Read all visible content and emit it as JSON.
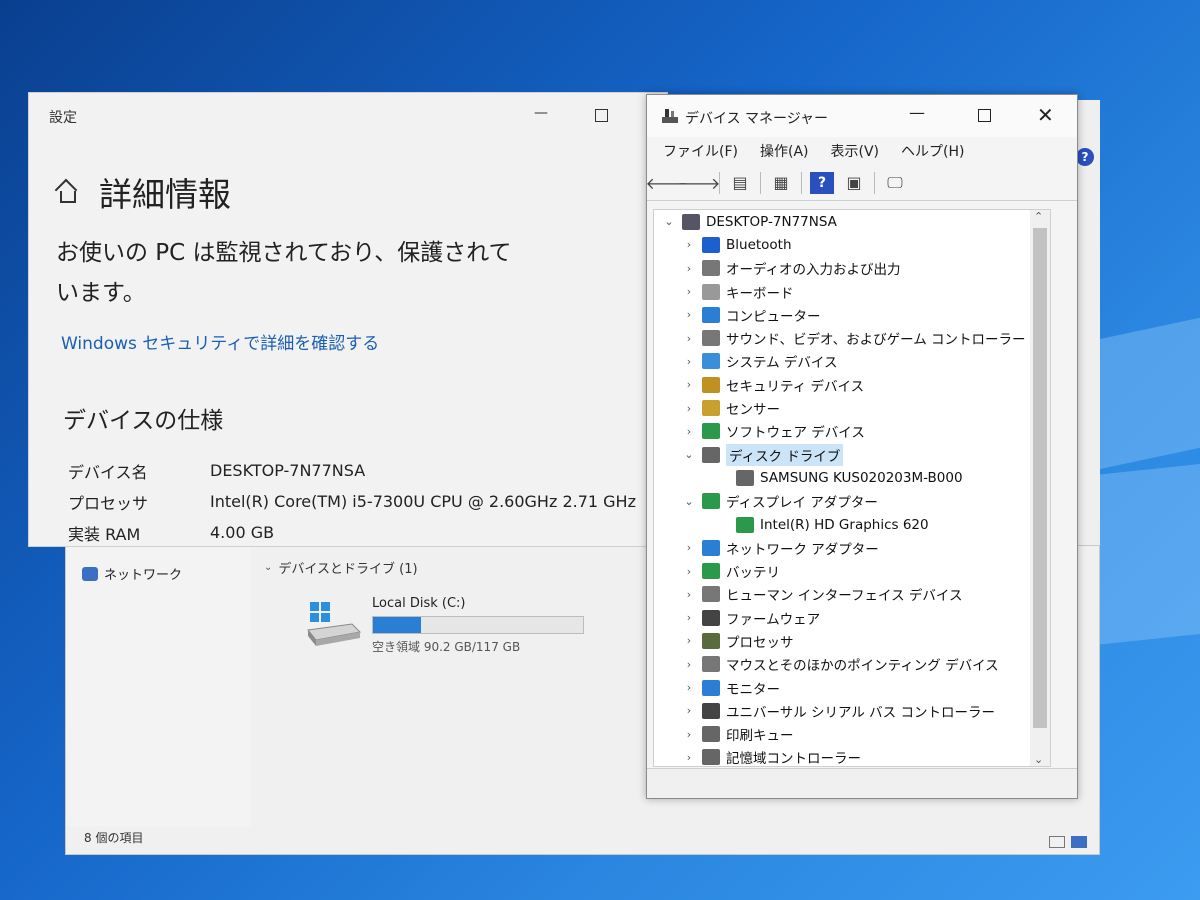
{
  "explorer": {
    "nav_network": "ネットワーク",
    "group_label": "デバイスとドライブ (1)",
    "drive": {
      "label": "Local Disk (C:)",
      "free_text": "空き領域 90.2 GB/117 GB",
      "used_fraction": 0.23
    },
    "status": "8 個の項目"
  },
  "settings": {
    "window_title": "設定",
    "heading": "詳細情報",
    "protect_text": "お使いの PC は監視されており、保護されています。",
    "security_link": "Windows セキュリティで詳細を確認する",
    "spec_heading": "デバイスの仕様",
    "specs": [
      {
        "key": "デバイス名",
        "value": "DESKTOP-7N77NSA"
      },
      {
        "key": "プロセッサ",
        "value": "Intel(R) Core(TM) i5-7300U CPU @ 2.60GHz   2.71 GHz"
      },
      {
        "key": "実装 RAM",
        "value": "4.00 GB"
      }
    ]
  },
  "devmgr": {
    "title": "デバイス マネージャー",
    "menu": [
      "ファイル(F)",
      "操作(A)",
      "表示(V)",
      "ヘルプ(H)"
    ],
    "tree": [
      {
        "label": "DESKTOP-7N77NSA",
        "level": 0,
        "toggle": "v",
        "icon": "computer",
        "color": "#556"
      },
      {
        "label": "Bluetooth",
        "level": 1,
        "toggle": ">",
        "icon": "bluetooth",
        "color": "#1e5fd0"
      },
      {
        "label": "オーディオの入力および出力",
        "level": 1,
        "toggle": ">",
        "icon": "speaker",
        "color": "#777"
      },
      {
        "label": "キーボード",
        "level": 1,
        "toggle": ">",
        "icon": "keyboard",
        "color": "#999"
      },
      {
        "label": "コンピューター",
        "level": 1,
        "toggle": ">",
        "icon": "monitor",
        "color": "#2a7fd4"
      },
      {
        "label": "サウンド、ビデオ、およびゲーム コントローラー",
        "level": 1,
        "toggle": ">",
        "icon": "speaker",
        "color": "#777"
      },
      {
        "label": "システム デバイス",
        "level": 1,
        "toggle": ">",
        "icon": "system",
        "color": "#3a8fd8"
      },
      {
        "label": "セキュリティ デバイス",
        "level": 1,
        "toggle": ">",
        "icon": "key",
        "color": "#c09020"
      },
      {
        "label": "センサー",
        "level": 1,
        "toggle": ">",
        "icon": "sensor",
        "color": "#c8a030"
      },
      {
        "label": "ソフトウェア デバイス",
        "level": 1,
        "toggle": ">",
        "icon": "software",
        "color": "#2a9a4a"
      },
      {
        "label": "ディスク ドライブ",
        "level": 1,
        "toggle": "v",
        "icon": "disk",
        "color": "#666",
        "selected": true
      },
      {
        "label": "SAMSUNG KUS020203M-B000",
        "level": 2,
        "toggle": "",
        "icon": "disk",
        "color": "#666"
      },
      {
        "label": "ディスプレイ アダプター",
        "level": 1,
        "toggle": "v",
        "icon": "display",
        "color": "#2a9a4a"
      },
      {
        "label": "Intel(R) HD Graphics 620",
        "level": 2,
        "toggle": "",
        "icon": "display",
        "color": "#2a9a4a"
      },
      {
        "label": "ネットワーク アダプター",
        "level": 1,
        "toggle": ">",
        "icon": "network",
        "color": "#2a7fd4"
      },
      {
        "label": "バッテリ",
        "level": 1,
        "toggle": ">",
        "icon": "battery",
        "color": "#2a9a4a"
      },
      {
        "label": "ヒューマン インターフェイス デバイス",
        "level": 1,
        "toggle": ">",
        "icon": "hid",
        "color": "#777"
      },
      {
        "label": "ファームウェア",
        "level": 1,
        "toggle": ">",
        "icon": "firmware",
        "color": "#444"
      },
      {
        "label": "プロセッサ",
        "level": 1,
        "toggle": ">",
        "icon": "cpu",
        "color": "#5a6a3a"
      },
      {
        "label": "マウスとそのほかのポインティング デバイス",
        "level": 1,
        "toggle": ">",
        "icon": "mouse",
        "color": "#777"
      },
      {
        "label": "モニター",
        "level": 1,
        "toggle": ">",
        "icon": "monitor",
        "color": "#2a7fd4"
      },
      {
        "label": "ユニバーサル シリアル バス コントローラー",
        "level": 1,
        "toggle": ">",
        "icon": "usb",
        "color": "#444"
      },
      {
        "label": "印刷キュー",
        "level": 1,
        "toggle": ">",
        "icon": "printer",
        "color": "#666"
      },
      {
        "label": "記憶域コントローラー",
        "level": 1,
        "toggle": ">",
        "icon": "storage",
        "color": "#666"
      }
    ]
  }
}
